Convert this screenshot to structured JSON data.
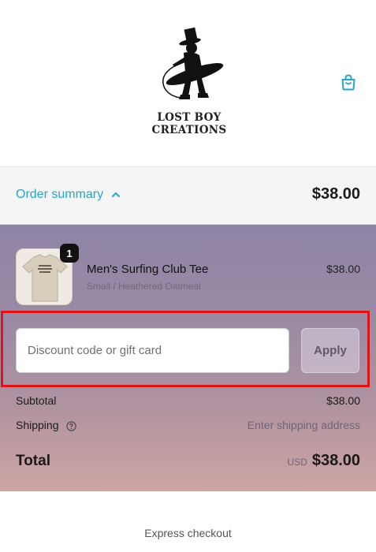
{
  "brand": {
    "name": "LOST BOY CREATIONS"
  },
  "icons": {
    "cart": "shopping-bag-icon",
    "chevron": "chevron-up-icon",
    "help": "help-circle-icon"
  },
  "colors": {
    "accent": "#29a6c2",
    "highlight": "#e0131a"
  },
  "summary": {
    "toggle_label": "Order summary",
    "total": "$38.00"
  },
  "items": [
    {
      "quantity": "1",
      "name": "Men's Surfing Club Tee",
      "variant": "Small / Heathered Oatmeal",
      "price": "$38.00"
    }
  ],
  "discount": {
    "placeholder": "Discount code or gift card",
    "apply_label": "Apply"
  },
  "totals": {
    "subtotal_label": "Subtotal",
    "subtotal_value": "$38.00",
    "shipping_label": "Shipping",
    "shipping_value": "Enter shipping address",
    "total_label": "Total",
    "currency": "USD",
    "total_value": "$38.00"
  },
  "express": {
    "label": "Express checkout"
  }
}
